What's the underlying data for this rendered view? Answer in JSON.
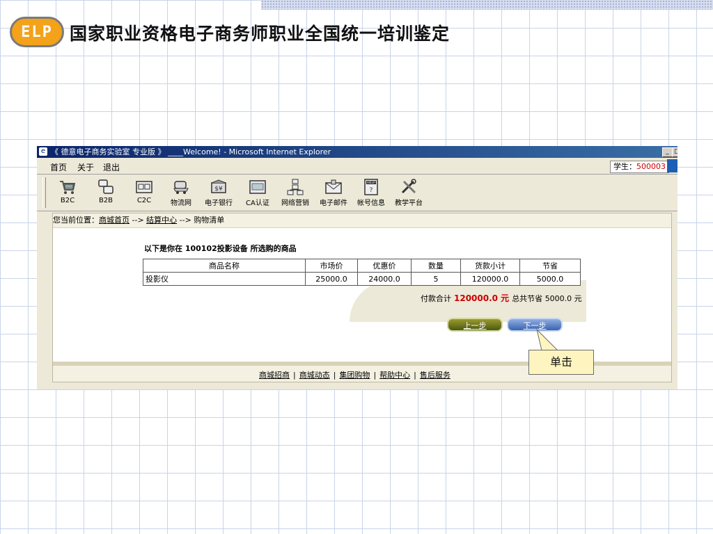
{
  "slide": {
    "logo_text": "ELP",
    "title": "国家职业资格电子商务师职业全国统一培训鉴定"
  },
  "browser": {
    "title": "《 德意电子商务实验室 专业版 》 ____Welcome! - Microsoft Internet Explorer",
    "menu": [
      "首页",
      "关于",
      "退出"
    ],
    "student_label": "学生：",
    "student_id": "500003"
  },
  "toolbar": {
    "items": [
      {
        "label": "B2C",
        "icon": "cart-icon"
      },
      {
        "label": "B2B",
        "icon": "b2b-icon"
      },
      {
        "label": "C2C",
        "icon": "c2c-icon"
      },
      {
        "label": "物流网",
        "icon": "truck-icon"
      },
      {
        "label": "电子银行",
        "icon": "bank-icon"
      },
      {
        "label": "CA认证",
        "icon": "certificate-icon"
      },
      {
        "label": "网络营销",
        "icon": "network-icon"
      },
      {
        "label": "电子邮件",
        "icon": "mail-icon"
      },
      {
        "label": "帐号信息",
        "icon": "help-icon"
      },
      {
        "label": "教学平台",
        "icon": "tools-icon"
      }
    ]
  },
  "breadcrumb": {
    "prefix": "您当前位置：",
    "home": "商城首页",
    "arrow": "-->",
    "checkout": "结算中心",
    "current": "购物清单"
  },
  "page": {
    "heading": "以下是你在  100102投影设备  所选购的商品",
    "columns": [
      "商品名称",
      "市场价",
      "优惠价",
      "数量",
      "货款小计",
      "节省"
    ],
    "rows": [
      [
        "投影仪",
        "25000.0",
        "24000.0",
        "5",
        "120000.0",
        "5000.0"
      ]
    ],
    "total_label": "付款合计",
    "total_amount": "120000.0 元",
    "savings_label": "总共节省",
    "savings_amount": "5000.0 元",
    "prev_button": "上一步",
    "next_button": "下一步"
  },
  "footer": {
    "links": [
      "商城招商",
      "商城动态",
      "集团购物",
      "帮助中心",
      "售后服务"
    ],
    "separator": "|"
  },
  "callout": {
    "text": "单击"
  },
  "colors": {
    "price_highlight": "#cc0000",
    "titlebar": "#0a246a",
    "callout_bg": "#fef4c0"
  }
}
